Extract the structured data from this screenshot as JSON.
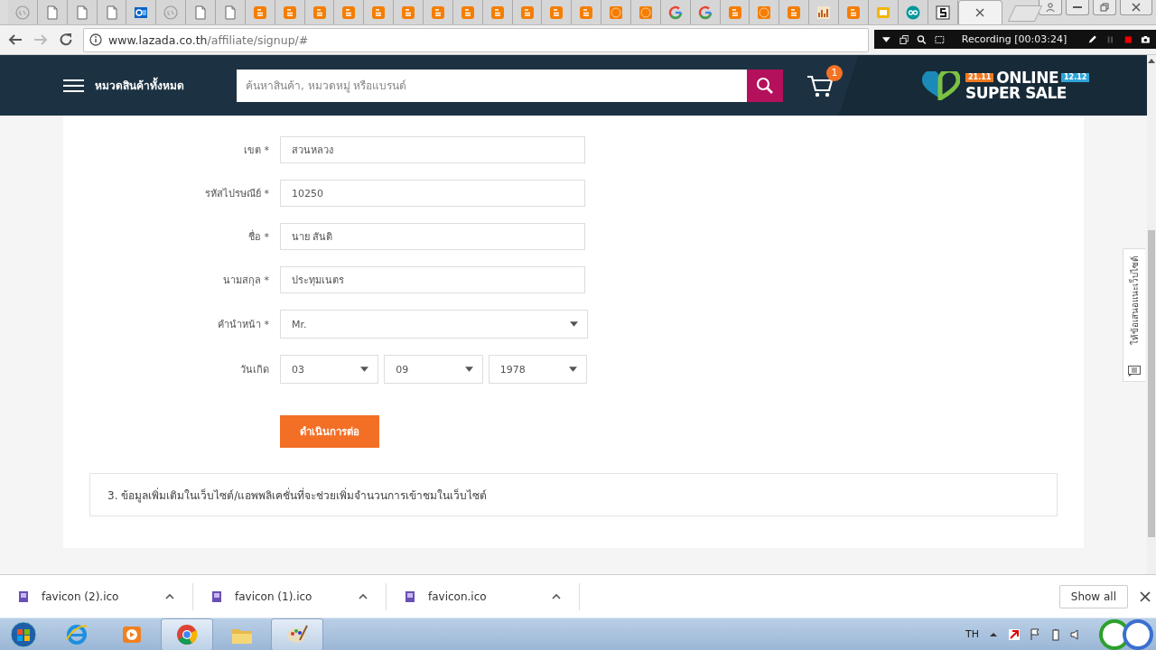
{
  "browser": {
    "tabs": [
      {
        "kind": "laz",
        "selected": false
      },
      {
        "kind": "page",
        "selected": false
      },
      {
        "kind": "page",
        "selected": false
      },
      {
        "kind": "page",
        "selected": false
      },
      {
        "kind": "outlook",
        "selected": false
      },
      {
        "kind": "laz",
        "selected": false
      },
      {
        "kind": "page",
        "selected": false
      },
      {
        "kind": "page",
        "selected": false
      },
      {
        "kind": "blogger",
        "selected": false
      },
      {
        "kind": "blogger",
        "selected": false
      },
      {
        "kind": "blogger",
        "selected": false
      },
      {
        "kind": "blogger",
        "selected": false
      },
      {
        "kind": "blogger",
        "selected": false
      },
      {
        "kind": "blogger",
        "selected": false
      },
      {
        "kind": "blogger",
        "selected": false
      },
      {
        "kind": "blogger",
        "selected": false
      },
      {
        "kind": "blogger",
        "selected": false
      },
      {
        "kind": "blogger",
        "selected": false
      },
      {
        "kind": "blogger",
        "selected": false
      },
      {
        "kind": "blogger",
        "selected": false
      },
      {
        "kind": "laz-orange",
        "selected": false
      },
      {
        "kind": "laz-orange",
        "selected": false
      },
      {
        "kind": "google",
        "selected": false
      },
      {
        "kind": "google",
        "selected": false
      },
      {
        "kind": "blogger",
        "selected": false
      },
      {
        "kind": "laz-orange",
        "selected": false
      },
      {
        "kind": "blogger",
        "selected": false
      },
      {
        "kind": "chart",
        "selected": false
      },
      {
        "kind": "blogger",
        "selected": false
      },
      {
        "kind": "slides",
        "selected": false
      },
      {
        "kind": "arduino",
        "selected": false
      },
      {
        "kind": "s",
        "selected": false
      },
      {
        "selected": true
      }
    ],
    "address_bar": {
      "host": "www.lazada.co.th",
      "path": "/affiliate/signup/#"
    },
    "recorder": {
      "status": "Recording [00:03:24]"
    }
  },
  "header": {
    "menu_label": "หมวดสินค้าทั้งหมด",
    "search": {
      "placeholder": "ค้นหาสินค้า, หมวดหมู่ หรือแบรนด์"
    },
    "cart_count": "1",
    "promo": {
      "left_date": "21.11",
      "title_1": "ONLINE",
      "right_date": "12.12",
      "title_2": "SUPER SALE"
    }
  },
  "form": {
    "fields": [
      {
        "kind": "text",
        "label": "เขต *",
        "value": "สวนหลวง"
      },
      {
        "kind": "text",
        "label": "รหัสไปรษณีย์ *",
        "value": "10250"
      },
      {
        "kind": "text",
        "label": "ชื่อ *",
        "value": "นาย สันติ"
      },
      {
        "kind": "text",
        "label": "นามสกุล *",
        "value": "ประทุมเนตร"
      },
      {
        "kind": "select",
        "label": "คำนำหน้า *",
        "value": "Mr."
      },
      {
        "kind": "date",
        "label": "วันเกิด",
        "values": [
          "03",
          "09",
          "1978"
        ]
      }
    ],
    "submit": "ดำเนินการต่อ"
  },
  "section": {
    "title": "3. ข้อมูลเพิ่มเติมในเว็บไซต์/แอพพลิเคชั่นที่จะช่วยเพิ่มจำนวนการเข้าชมในเว็บไซต์"
  },
  "feedback_tab": "ให้ข้อเสนอแนะเว็บไซต์",
  "downloads": {
    "items": [
      {
        "name": "favicon (2).ico"
      },
      {
        "name": "favicon (1).ico"
      },
      {
        "name": "favicon.ico"
      }
    ],
    "show_all": "Show all"
  },
  "taskbar": {
    "apps": [
      {
        "kind": "ie",
        "selected": false
      },
      {
        "kind": "media",
        "selected": false
      },
      {
        "kind": "chrome",
        "selected": true
      },
      {
        "kind": "folder",
        "selected": false
      },
      {
        "kind": "paint",
        "selected": true
      }
    ],
    "language": "TH"
  }
}
